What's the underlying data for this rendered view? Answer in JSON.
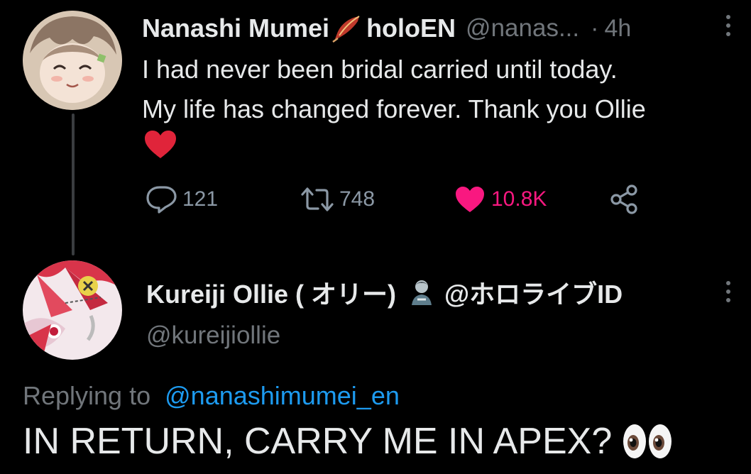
{
  "tweet": {
    "author_name": "Nanashi Mumei",
    "author_affiliation": "holoEN",
    "author_handle": "@nanas...",
    "separator": "·",
    "time": "4h",
    "text_line1": "I had never been bridal carried until today.",
    "text_line2": "My life has changed forever. Thank you Ollie",
    "emoji": "heart-icon",
    "stats": {
      "replies": "121",
      "retweets": "748",
      "likes": "10.8K"
    },
    "liked": true
  },
  "reply": {
    "author_name": "Kureiji Ollie ( オリー)",
    "author_affiliation": "@ホロライブID",
    "author_handle": "@kureijiollie",
    "replying_label": "Replying to",
    "replying_to": "@nanashimumei_en",
    "text": "IN RETURN, CARRY ME IN APEX?",
    "emoji": "eyes-icon"
  },
  "icons": [
    "feather-icon",
    "more-icon",
    "reply-icon",
    "retweet-icon",
    "like-icon",
    "share-icon",
    "zombie-icon",
    "eyes-icon"
  ],
  "colors": {
    "background": "#000000",
    "text": "#e7e9ea",
    "secondary": "#71767b",
    "like": "#f91880",
    "link": "#1d9bf0",
    "heart_emoji": "#e0243a"
  }
}
